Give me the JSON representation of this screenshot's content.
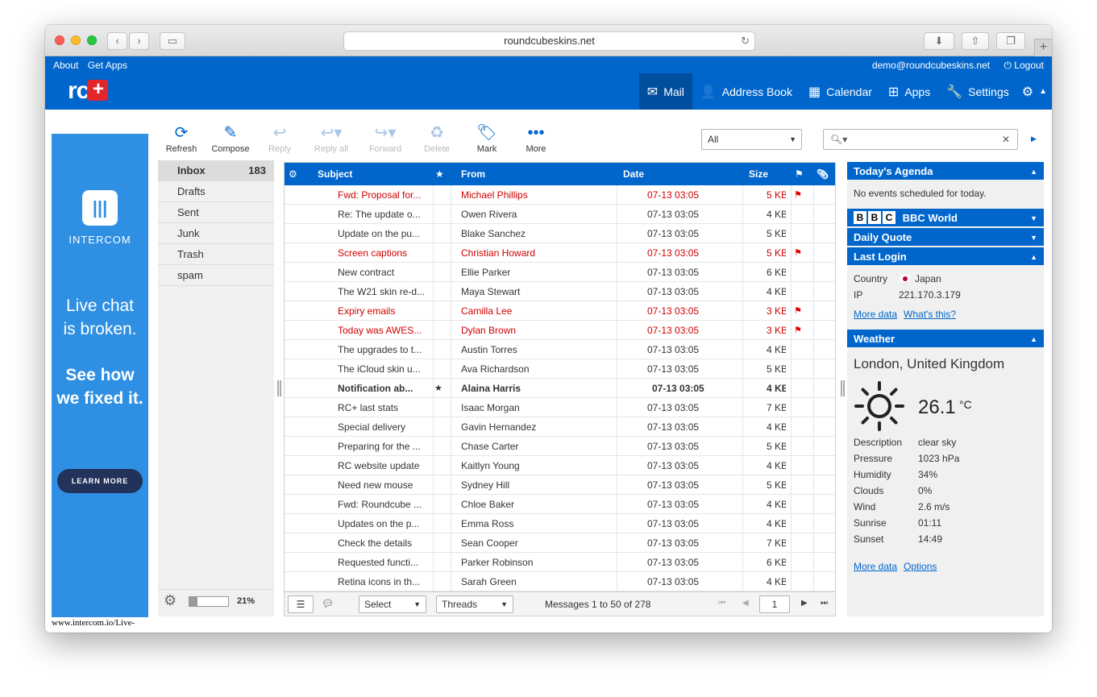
{
  "browser": {
    "url": "roundcubeskins.net"
  },
  "header": {
    "about": "About",
    "get_apps": "Get Apps",
    "user": "demo@roundcubeskins.net",
    "logout": "Logout",
    "logo_text": "rc",
    "logo_plus": "+",
    "nav": {
      "mail": "Mail",
      "address_book": "Address Book",
      "calendar": "Calendar",
      "apps": "Apps",
      "settings": "Settings"
    }
  },
  "ad": {
    "brand": "INTERCOM",
    "line1a": "Live chat",
    "line1b": "is broken.",
    "line2a": "See how",
    "line2b": "we fixed it.",
    "button": "LEARN MORE",
    "url": "www.intercom.io/Live-"
  },
  "toolbar": {
    "refresh": "Refresh",
    "compose": "Compose",
    "reply": "Reply",
    "reply_all": "Reply all",
    "forward": "Forward",
    "delete": "Delete",
    "mark": "Mark",
    "more": "More",
    "filter": "All"
  },
  "folders": [
    {
      "name": "Inbox",
      "count": "183"
    },
    {
      "name": "Drafts",
      "count": ""
    },
    {
      "name": "Sent",
      "count": ""
    },
    {
      "name": "Junk",
      "count": ""
    },
    {
      "name": "Trash",
      "count": ""
    },
    {
      "name": "spam",
      "count": ""
    }
  ],
  "quota": {
    "percent": 21,
    "label": "21%"
  },
  "list_headers": {
    "subject": "Subject",
    "from": "From",
    "date": "Date",
    "size": "Size"
  },
  "messages": [
    {
      "subject": "Fwd: Proposal for...",
      "from": "Michael Phillips",
      "date": "07-13 03:05",
      "size": "5 KB",
      "flagged": true,
      "unread": false,
      "starred": false
    },
    {
      "subject": "Re: The update o...",
      "from": "Owen Rivera",
      "date": "07-13 03:05",
      "size": "4 KB",
      "flagged": false,
      "unread": false,
      "starred": false
    },
    {
      "subject": "Update on the pu...",
      "from": "Blake Sanchez",
      "date": "07-13 03:05",
      "size": "5 KB",
      "flagged": false,
      "unread": false,
      "starred": false
    },
    {
      "subject": "Screen captions",
      "from": "Christian Howard",
      "date": "07-13 03:05",
      "size": "5 KB",
      "flagged": true,
      "unread": false,
      "starred": false
    },
    {
      "subject": "New contract",
      "from": "Ellie Parker",
      "date": "07-13 03:05",
      "size": "6 KB",
      "flagged": false,
      "unread": false,
      "starred": false
    },
    {
      "subject": "The W21 skin re-d...",
      "from": "Maya Stewart",
      "date": "07-13 03:05",
      "size": "4 KB",
      "flagged": false,
      "unread": false,
      "starred": false
    },
    {
      "subject": "Expiry emails",
      "from": "Camilla Lee",
      "date": "07-13 03:05",
      "size": "3 KB",
      "flagged": true,
      "unread": false,
      "starred": false
    },
    {
      "subject": "Today was AWES...",
      "from": "Dylan Brown",
      "date": "07-13 03:05",
      "size": "3 KB",
      "flagged": true,
      "unread": false,
      "starred": false
    },
    {
      "subject": "The upgrades to t...",
      "from": "Austin Torres",
      "date": "07-13 03:05",
      "size": "4 KB",
      "flagged": false,
      "unread": false,
      "starred": false
    },
    {
      "subject": "The iCloud skin u...",
      "from": "Ava Richardson",
      "date": "07-13 03:05",
      "size": "5 KB",
      "flagged": false,
      "unread": false,
      "starred": false
    },
    {
      "subject": "Notification ab...",
      "from": "Alaina Harris",
      "date": "07-13 03:05",
      "size": "4 KB",
      "flagged": false,
      "unread": true,
      "starred": true
    },
    {
      "subject": "RC+ last stats",
      "from": "Isaac Morgan",
      "date": "07-13 03:05",
      "size": "7 KB",
      "flagged": false,
      "unread": false,
      "starred": false
    },
    {
      "subject": "Special delivery",
      "from": "Gavin Hernandez",
      "date": "07-13 03:05",
      "size": "4 KB",
      "flagged": false,
      "unread": false,
      "starred": false
    },
    {
      "subject": "Preparing for the ...",
      "from": "Chase Carter",
      "date": "07-13 03:05",
      "size": "5 KB",
      "flagged": false,
      "unread": false,
      "starred": false
    },
    {
      "subject": "RC website update",
      "from": "Kaitlyn Young",
      "date": "07-13 03:05",
      "size": "4 KB",
      "flagged": false,
      "unread": false,
      "starred": false
    },
    {
      "subject": "Need new mouse",
      "from": "Sydney Hill",
      "date": "07-13 03:05",
      "size": "5 KB",
      "flagged": false,
      "unread": false,
      "starred": false
    },
    {
      "subject": "Fwd: Roundcube ...",
      "from": "Chloe Baker",
      "date": "07-13 03:05",
      "size": "4 KB",
      "flagged": false,
      "unread": false,
      "starred": false
    },
    {
      "subject": "Updates on the p...",
      "from": "Emma Ross",
      "date": "07-13 03:05",
      "size": "4 KB",
      "flagged": false,
      "unread": false,
      "starred": false
    },
    {
      "subject": "Check the details",
      "from": "Sean Cooper",
      "date": "07-13 03:05",
      "size": "7 KB",
      "flagged": false,
      "unread": false,
      "starred": false
    },
    {
      "subject": "Requested functi...",
      "from": "Parker Robinson",
      "date": "07-13 03:05",
      "size": "6 KB",
      "flagged": false,
      "unread": false,
      "starred": false
    },
    {
      "subject": "Retina icons in th...",
      "from": "Sarah Green",
      "date": "07-13 03:05",
      "size": "4 KB",
      "flagged": false,
      "unread": false,
      "starred": false
    }
  ],
  "list_footer": {
    "select": "Select",
    "threads": "Threads",
    "count_text": "Messages 1 to 50 of 278",
    "page": "1"
  },
  "right_panel": {
    "agenda_title": "Today's Agenda",
    "agenda_text": "No events scheduled for today.",
    "bbc_title": "BBC World",
    "bbc_letters": [
      "B",
      "B",
      "C"
    ],
    "quote_title": "Daily Quote",
    "last_login_title": "Last Login",
    "country_label": "Country",
    "country_value": "Japan",
    "ip_label": "IP",
    "ip_value": "221.170.3.179",
    "more_data": "More data",
    "whats_this": "What's this?",
    "weather_title": "Weather",
    "city": "London, United Kingdom",
    "temp": "26.1",
    "temp_unit": "°C",
    "weather_rows": [
      {
        "k": "Description",
        "v": "clear sky"
      },
      {
        "k": "Pressure",
        "v": "1023 hPa"
      },
      {
        "k": "Humidity",
        "v": "34%"
      },
      {
        "k": "Clouds",
        "v": "0%"
      },
      {
        "k": "Wind",
        "v": "2.6 m/s"
      },
      {
        "k": "Sunrise",
        "v": "01:11"
      },
      {
        "k": "Sunset",
        "v": "14:49"
      }
    ],
    "weather_more": "More data",
    "weather_options": "Options"
  }
}
